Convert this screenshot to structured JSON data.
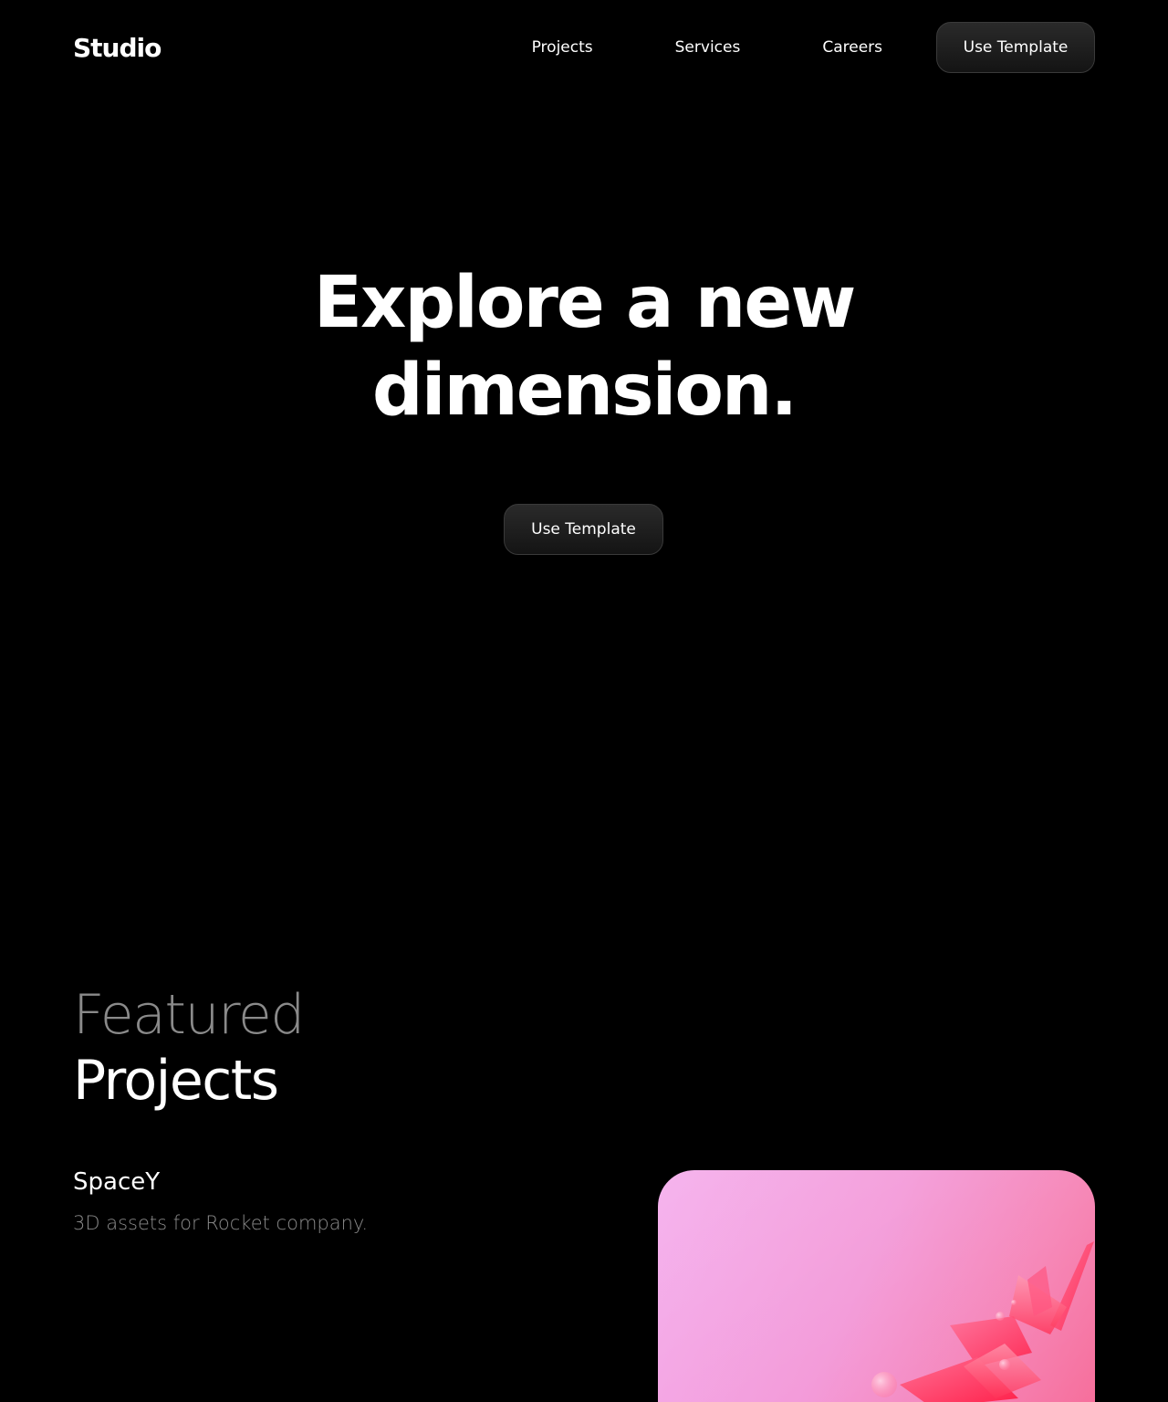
{
  "header": {
    "logo": "Studio",
    "nav": [
      {
        "label": "Projects"
      },
      {
        "label": "Services"
      },
      {
        "label": "Careers"
      }
    ],
    "cta_label": "Use Template"
  },
  "hero": {
    "title_line1": "Explore a new",
    "title_line2": "dimension.",
    "cta_label": "Use Template"
  },
  "featured": {
    "title_light": "Featured",
    "title_bold": "Projects",
    "projects": [
      {
        "name": "SpaceY",
        "description": "3D assets for Rocket company.",
        "image_alt": "pink 3d shapes render"
      }
    ]
  },
  "colors": {
    "background": "#000000",
    "text": "#ffffff",
    "muted": "#8a8a8a",
    "button_bg": "#1c1c1c",
    "card_pink": "#f293d6",
    "accent_red": "#ff2a55"
  }
}
